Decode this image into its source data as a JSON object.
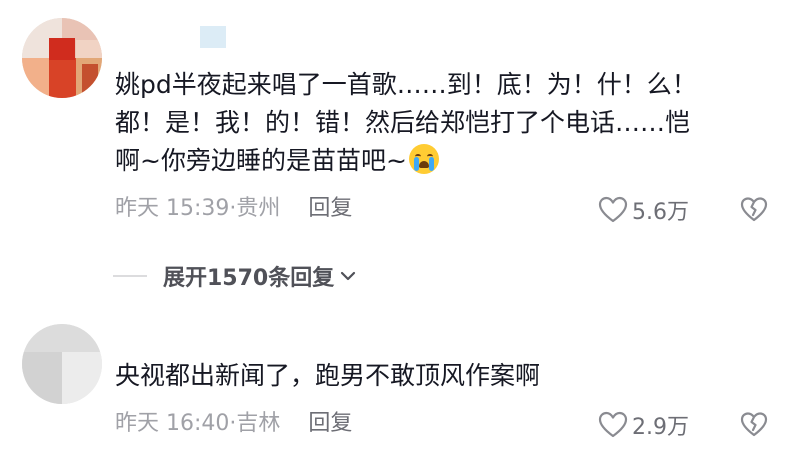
{
  "comments": [
    {
      "text_lines": [
        "姚pd半夜起来唱了一首歌……到！底！为！什！么！",
        "都！是！我！的！错！然后给郑恺打了个电话……恺",
        "啊~你旁边睡的是苗苗吧~"
      ],
      "emoji": "loudly-crying-face-icon",
      "time": "昨天 15:39",
      "location": "贵州",
      "reply_label": "回复",
      "likes": "5.6万"
    },
    {
      "text_lines": [
        "央视都出新闻了，跑男不敢顶风作案啊"
      ],
      "time": "昨天 16:40",
      "location": "吉林",
      "reply_label": "回复",
      "likes": "2.9万"
    }
  ],
  "expand_replies": {
    "label": "展开1570条回复"
  },
  "colors": {
    "text": "#161823",
    "meta": "#a0a1a7",
    "action": "#6d6e75",
    "expand": "#505158"
  }
}
